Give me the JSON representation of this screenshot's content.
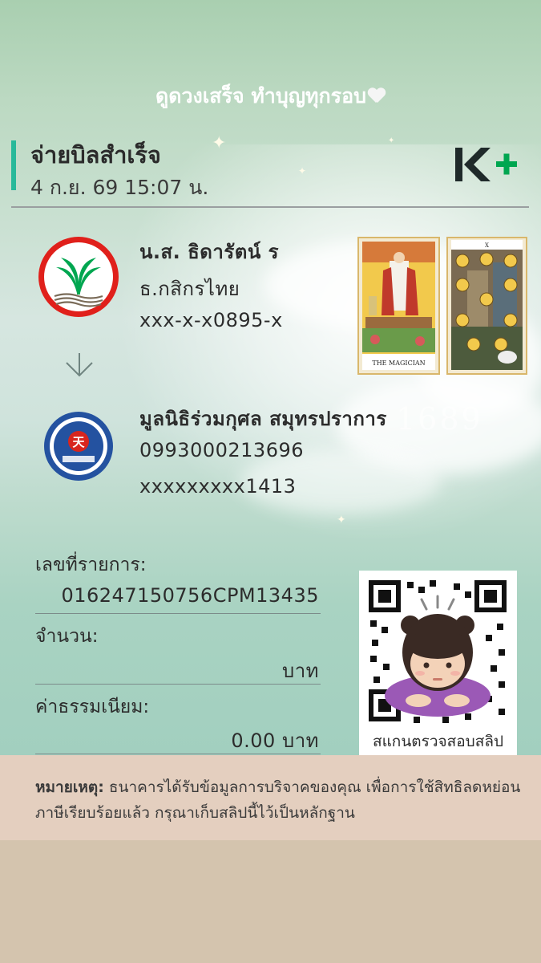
{
  "header": {
    "caption": "ดูดวงเสร็จ ทำบุญทุกรอบ"
  },
  "receipt": {
    "title": "จ่ายบิลสำเร็จ",
    "datetime": "4 ก.ย. 69  15:07 น.",
    "brand_logo": "K+"
  },
  "sender": {
    "name": "น.ส. ธิดารัตน์ ร",
    "bank": "ธ.กสิกรไทย",
    "account": "xxx-x-x0895-x",
    "logo_icon": "kasikorn-bank-logo"
  },
  "receiver": {
    "name": "มูลนิธิร่วมกุศล สมุทรปราการ",
    "biller_id": "0993000213696",
    "reference": "xxxxxxxxx1413",
    "logo_icon": "foundation-seal-logo"
  },
  "decorations": {
    "tarot_card_1": "THE MAGICIAN",
    "tarot_card_2": "X",
    "year_watermark": "1689"
  },
  "transaction": {
    "ref_label": "เลขที่รายการ:",
    "ref_value": "016247150756CPM13435",
    "amount_label": "จำนวน:",
    "amount_value": "บาท",
    "fee_label": "ค่าธรรมเนียม:",
    "fee_value": "0.00 บาท"
  },
  "qr": {
    "caption": "สแกนตรวจสอบสลิป"
  },
  "note": {
    "label": "หมายเหตุ:",
    "text": "ธนาคารได้รับข้อมูลการบริจาคของคุณ เพื่อการใช้สิทธิลดหย่อนภาษีเรียบร้อยแล้ว กรุณาเก็บสลิปนี้ไว้เป็นหลักฐาน"
  },
  "colors": {
    "accent": "#29b99a",
    "kbank_green": "#00a650",
    "kbank_red": "#e0201b",
    "note_bg": "#e4cfbf",
    "page_bg": "#d4c4ae"
  }
}
